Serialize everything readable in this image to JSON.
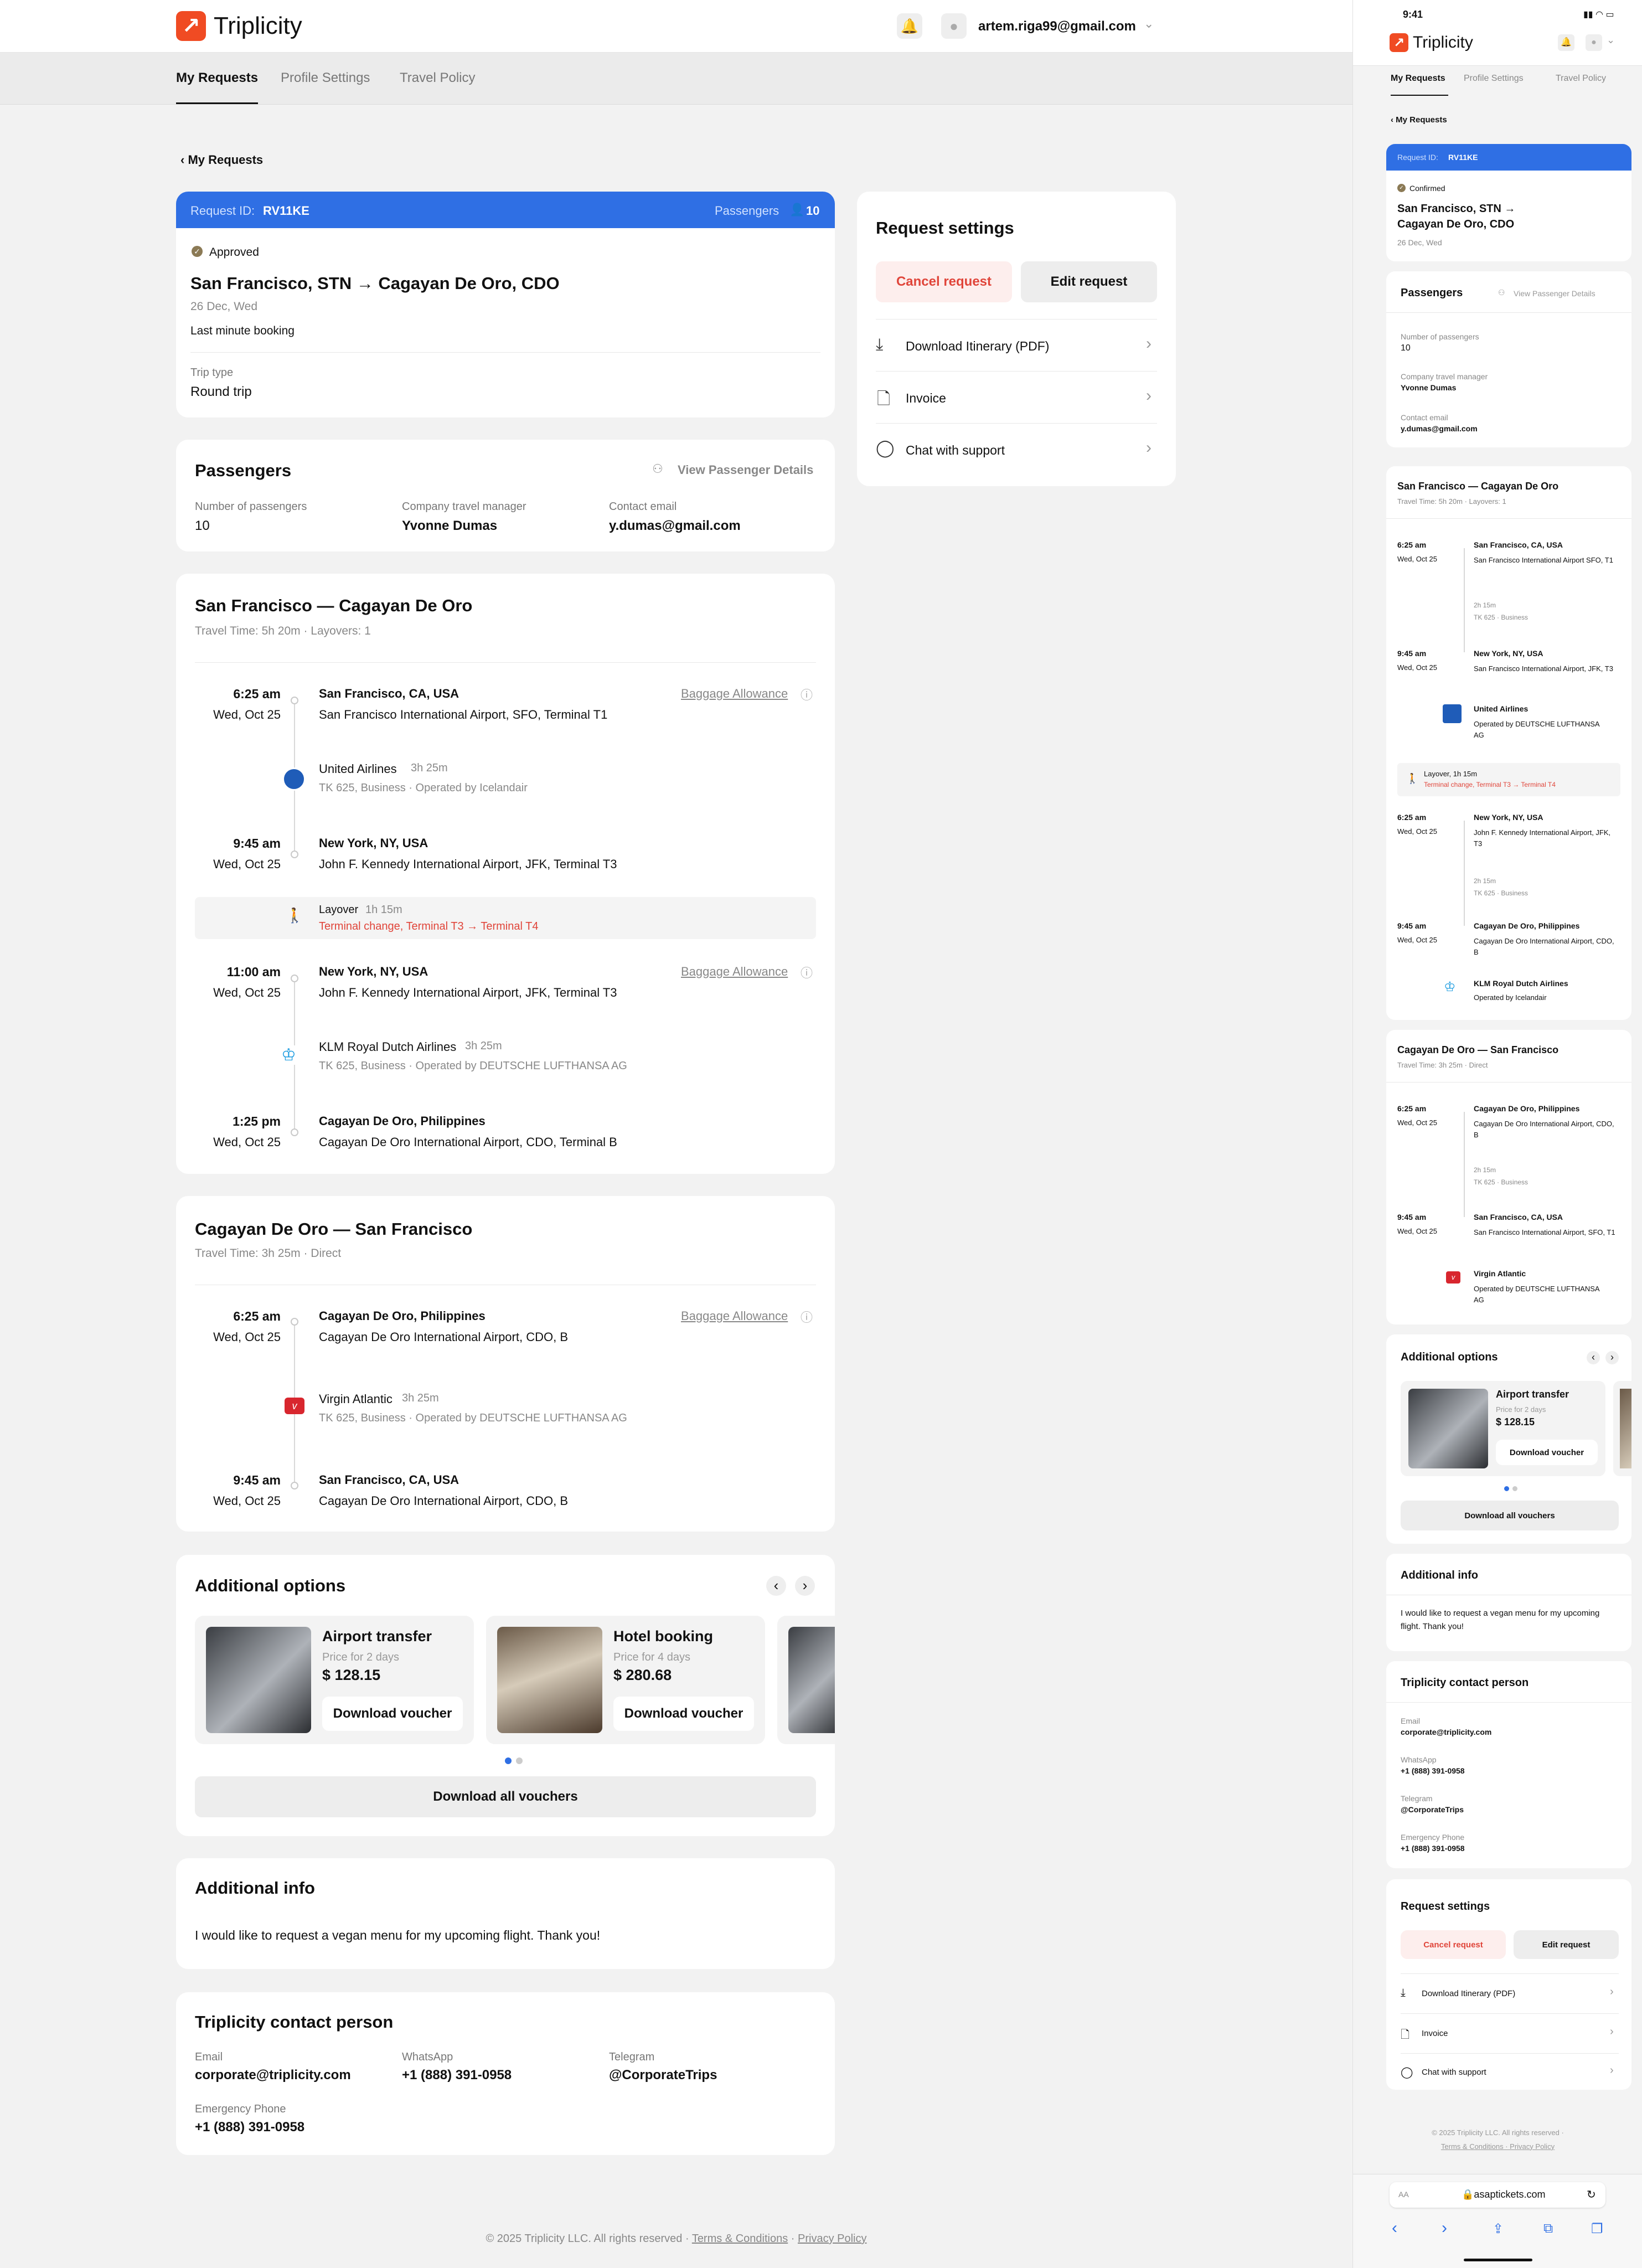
{
  "app": {
    "logo_text": "Triplicity",
    "brand_color": "#f04b23",
    "accent_color": "#2f6fe4"
  },
  "header": {
    "user_email": "artem.riga99@gmail.com",
    "icons": [
      "bell-icon",
      "user-icon",
      "chevron-down-icon"
    ]
  },
  "tabs": [
    "My Requests",
    "Profile Settings",
    "Travel Policy"
  ],
  "back_label": "My Requests",
  "request": {
    "id_label": "Request ID:",
    "id": "RV11KE",
    "passengers_label": "Passengers",
    "passengers_count": "10",
    "status": "Approved",
    "route": "San Francisco, STN → Cagayan De Oro, CDO",
    "date": "26 Dec, Wed",
    "note": "Last minute booking",
    "trip_type_label": "Trip type",
    "trip_type": "Round trip"
  },
  "passengers": {
    "title": "Passengers",
    "view_details": "View Passenger Details",
    "count_label": "Number of passengers",
    "count": "10",
    "manager_label": "Company travel manager",
    "manager": "Yvonne Dumas",
    "email_label": "Contact email",
    "email": "y.dumas@gmail.com"
  },
  "outbound": {
    "title": "San Francisco — Cagayan De Oro",
    "subtitle": "Travel Time: 5h 20m · Layovers: 1",
    "baggage": "Baggage Allowance",
    "seg1": {
      "dep_time": "6:25 am",
      "dep_date": "Wed, Oct 25",
      "dep_city": "San Francisco, CA, USA",
      "dep_airport": "San Francisco International Airport, SFO, Terminal T1",
      "airline": "United Airlines",
      "duration": "3h 25m",
      "details": "TK 625, Business · Operated by Icelandair",
      "arr_time": "9:45 am",
      "arr_date": "Wed, Oct 25",
      "arr_city": "New York, NY, USA",
      "arr_airport": "John F. Kennedy International Airport, JFK, Terminal T3"
    },
    "layover": {
      "label": "Layover",
      "duration": "1h 15m",
      "change": "Terminal change, Terminal T3 → Terminal T4"
    },
    "seg2": {
      "dep_time": "11:00 am",
      "dep_date": "Wed, Oct 25",
      "dep_city": "New York, NY, USA",
      "dep_airport": "John F. Kennedy International Airport, JFK, Terminal T3",
      "airline": "KLM Royal Dutch Airlines",
      "duration": "3h 25m",
      "details": "TK 625, Business · Operated by DEUTSCHE LUFTHANSA AG",
      "arr_time": "1:25 pm",
      "arr_date": "Wed, Oct 25",
      "arr_city": "Cagayan De Oro, Philippines",
      "arr_airport": "Cagayan De Oro International Airport, CDO, Terminal B"
    }
  },
  "return": {
    "title": "Cagayan De Oro — San Francisco",
    "subtitle": "Travel Time: 3h 25m · Direct",
    "baggage": "Baggage Allowance",
    "seg": {
      "dep_time": "6:25 am",
      "dep_date": "Wed, Oct 25",
      "dep_city": "Cagayan De Oro, Philippines",
      "dep_airport": "Cagayan De Oro International Airport, CDO, B",
      "airline": "Virgin Atlantic",
      "duration": "3h 25m",
      "details": "TK 625, Business · Operated by DEUTSCHE LUFTHANSA AG",
      "arr_time": "9:45 am",
      "arr_date": "Wed, Oct 25",
      "arr_city": "San Francisco, CA, USA",
      "arr_airport": "Cagayan De Oro International Airport, CDO, B"
    }
  },
  "options": {
    "title": "Additional options",
    "items": [
      {
        "name": "Airport transfer",
        "sub": "Price for 2 days",
        "price": "$ 128.15",
        "button": "Download voucher"
      },
      {
        "name": "Hotel booking",
        "sub": "Price for 4 days",
        "price": "$ 280.68",
        "button": "Download voucher"
      }
    ],
    "download_all": "Download all vouchers"
  },
  "additional_info": {
    "title": "Additional info",
    "text": "I would like to request a vegan menu for my upcoming flight. Thank you!"
  },
  "contact": {
    "title": "Triplicity contact person",
    "email_label": "Email",
    "email": "corporate@triplicity.com",
    "whatsapp_label": "WhatsApp",
    "whatsapp": "+1 (888) 391-0958",
    "telegram_label": "Telegram",
    "telegram": "@CorporateTrips",
    "emergency_label": "Emergency Phone",
    "emergency": "+1 (888) 391-0958"
  },
  "settings": {
    "title": "Request settings",
    "cancel": "Cancel request",
    "edit": "Edit request",
    "items": [
      "Download Itinerary (PDF)",
      "Invoice",
      "Chat with support"
    ]
  },
  "footer": {
    "copyright": "© 2025 Triplicity LLC. All rights reserved ·",
    "terms": "Terms & Conditions",
    "sep": "·",
    "privacy": "Privacy Policy"
  },
  "mobile": {
    "time": "9:41",
    "status": "Confirmed",
    "route_line1": "San Francisco, STN →",
    "route_line2": "Cagayan De Oro, CDO",
    "out_subtitle": "Travel Time: 5h 20m · Layovers: 1",
    "ret_subtitle": "Travel Time: 3h 25m · Direct",
    "seg_short": "TK 625 · Business",
    "leg_duration": "2h 15m",
    "layover": "Layover, 1h 15m",
    "layover_change": "Terminal change, Terminal T3 → Terminal T4",
    "sfo_airport": "San Francisco International Airport SFO, T1",
    "sfo_airport_arr": "San Francisco International Airport, JFK, T3",
    "jfk_airport": "John F. Kennedy International Airport, JFK, T3",
    "cdo_airport": "Cagayan De Oro International Airport, CDO, B",
    "sfo_airport_ret": "San Francisco International Airport, SFO, T1",
    "united_op": "Operated by DEUTSCHE LUFTHANSA AG",
    "klm_op": "Operated by Icelandair",
    "virgin_op": "Operated by DEUTSCHE LUFTHANSA AG",
    "footer_line1": "© 2025 Triplicity LLC. All rights reserved ·",
    "footer_line2": "Terms & Conditions · Privacy Policy",
    "url": "asaptickets.com",
    "aa": "AA"
  }
}
